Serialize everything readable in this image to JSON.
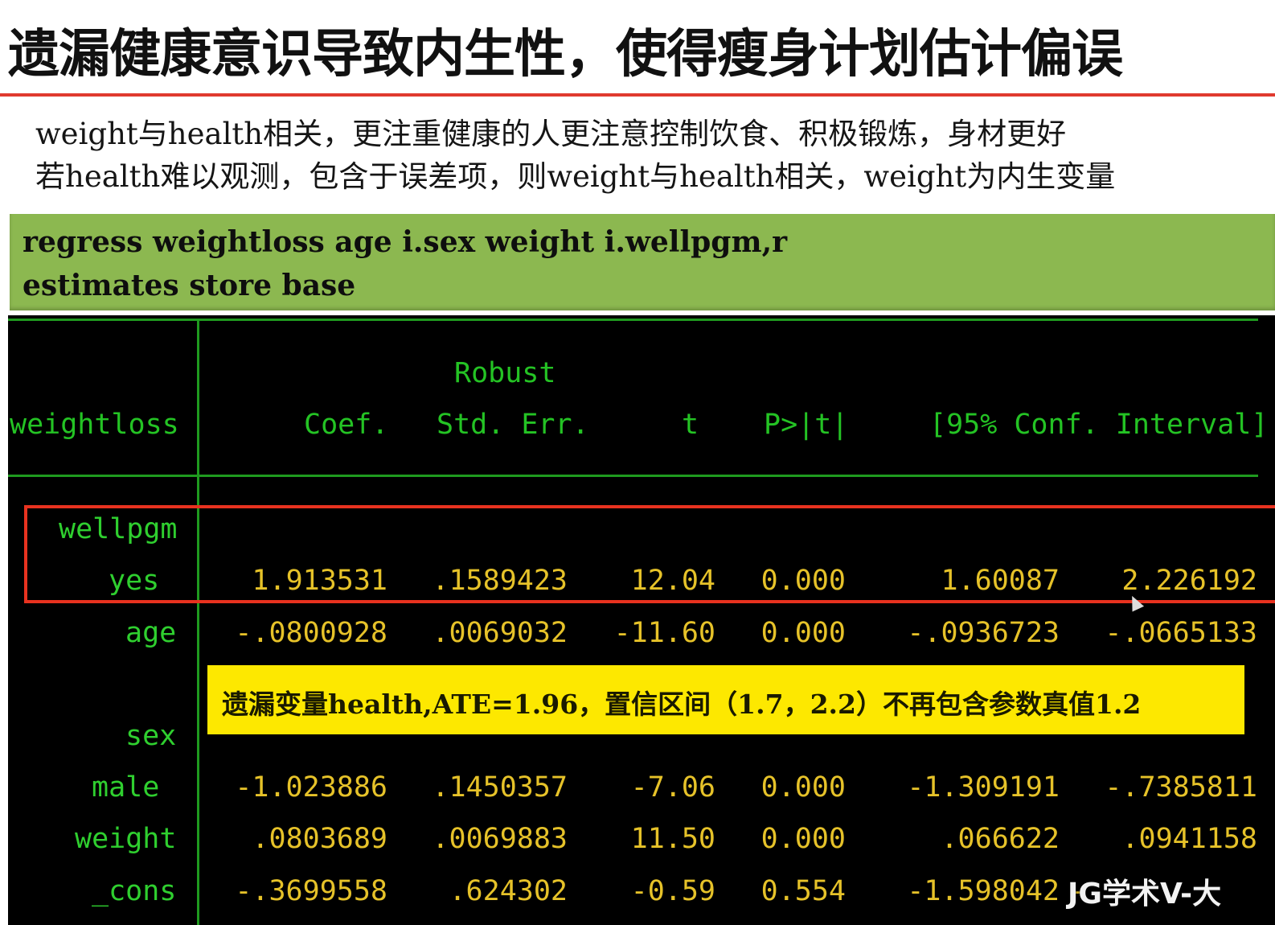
{
  "title": "遗漏健康意识导致内生性，使得瘦身计划估计偏误",
  "paragraphs": [
    "weight与health相关，更注重健康的人更注意控制饮食、积极锻炼，身材更好",
    "若health难以观测，包含于误差项，则weight与health相关，weight为内生变量"
  ],
  "commands": [
    "regress weightloss age i.sex weight i.wellpgm,r",
    "estimates store base"
  ],
  "table": {
    "header_top": "Robust",
    "dep_var": "weightloss",
    "columns": [
      "Coef.",
      "Std. Err.",
      "t",
      "P>|t|",
      "[95% Conf. Interval]"
    ],
    "rows": [
      {
        "label": "wellpgm",
        "values": []
      },
      {
        "label": "yes",
        "values": [
          "1.913531",
          ".1589423",
          "12.04",
          "0.000",
          "1.60087",
          "2.226192"
        ]
      },
      {
        "label": "age",
        "values": [
          "-.0800928",
          ".0069032",
          "-11.60",
          "0.000",
          "-.0936723",
          "-.0665133"
        ]
      },
      {
        "label": "sex",
        "values": []
      },
      {
        "label": "male",
        "values": [
          "-1.023886",
          ".1450357",
          "-7.06",
          "0.000",
          "-1.309191",
          "-.7385811"
        ]
      },
      {
        "label": "weight",
        "values": [
          ".0803689",
          ".0069883",
          "11.50",
          "0.000",
          ".066622",
          ".0941158"
        ]
      },
      {
        "label": "_cons",
        "values": [
          "-.3699558",
          ".624302",
          "-0.59",
          "0.554",
          "-1.598042",
          "-"
        ]
      }
    ]
  },
  "note": "遗漏变量health,ATE=1.96，置信区间（1.7，2.2）不再包含参数真值1.2",
  "watermark": "JG学术V-大",
  "colors": {
    "title_rule": "#e03a2f",
    "command_bg": "#8cb850",
    "console_bg": "#000000",
    "console_green": "#2fcf2f",
    "console_yellow": "#e6c229",
    "highlight_border": "#e8321f",
    "note_bg": "#fde800"
  }
}
